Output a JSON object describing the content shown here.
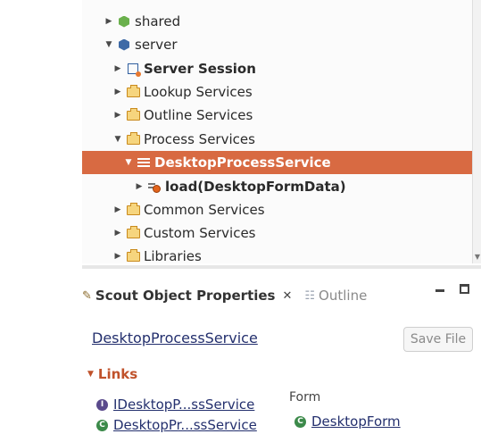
{
  "tree": {
    "items": [
      {
        "label": "shared",
        "expanded": false,
        "icon": "package-green-icon"
      },
      {
        "label": "server",
        "expanded": true,
        "icon": "package-blue-icon"
      },
      {
        "label": "Server Session",
        "expanded": false,
        "icon": "session-icon"
      },
      {
        "label": "Lookup Services",
        "expanded": false,
        "icon": "folder-icon"
      },
      {
        "label": "Outline Services",
        "expanded": false,
        "icon": "folder-icon"
      },
      {
        "label": "Process Services",
        "expanded": true,
        "icon": "folder-icon"
      },
      {
        "label": "DesktopProcessService",
        "expanded": true,
        "icon": "service-icon",
        "selected": true
      },
      {
        "label": "load(DesktopFormData)",
        "expanded": false,
        "icon": "operation-icon"
      },
      {
        "label": "Common Services",
        "expanded": false,
        "icon": "folder-icon"
      },
      {
        "label": "Custom Services",
        "expanded": false,
        "icon": "folder-icon"
      },
      {
        "label": "Libraries",
        "expanded": false,
        "icon": "folder-icon"
      }
    ]
  },
  "view": {
    "active_tab": "Scout Object Properties",
    "inactive_tab": "Outline"
  },
  "form": {
    "title": "DesktopProcessService",
    "save_label": "Save File",
    "section_title": "Links",
    "links": {
      "interface": "IDesktopP...ssService",
      "class": "DesktopPr...ssService",
      "form_label": "Form",
      "form_link": "DesktopForm"
    }
  },
  "colors": {
    "selection": "#d86a42",
    "link": "#24306e",
    "section": "#c0522b"
  }
}
